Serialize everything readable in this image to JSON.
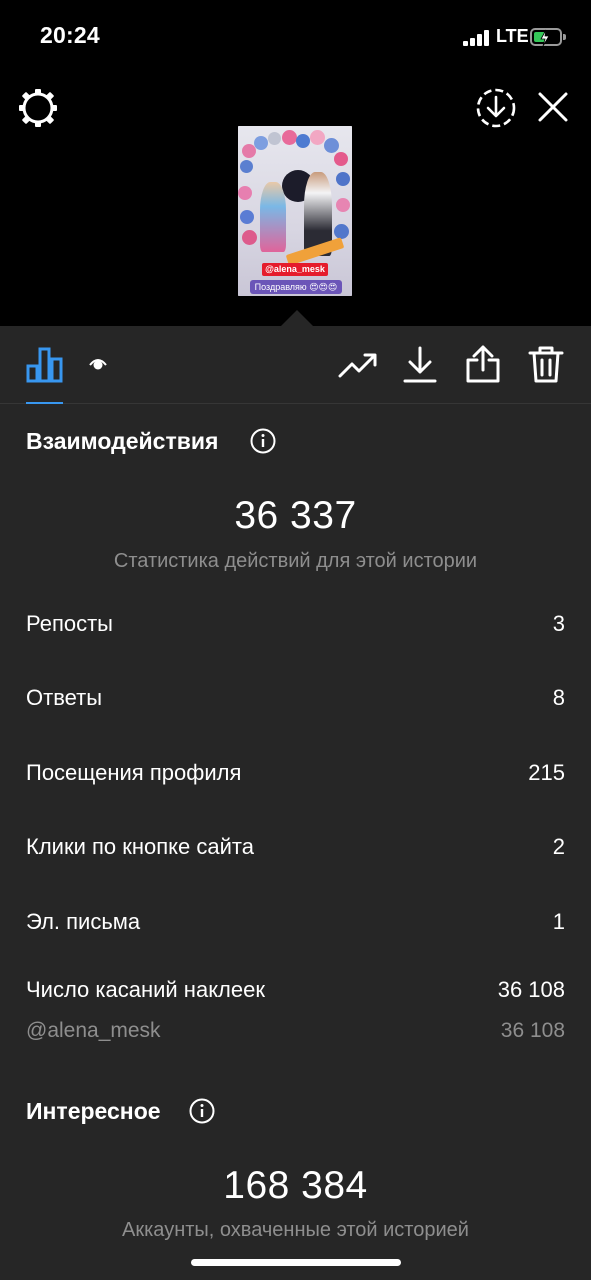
{
  "status_bar": {
    "time": "20:24",
    "network": "LTE"
  },
  "story": {
    "sticker_tag": "@alena_mesk",
    "caption": "Поздравляю 😍😍😍"
  },
  "toolbar": {
    "tabs": [
      "insights-icon",
      "eye-icon"
    ],
    "actions": [
      "trend-icon",
      "download-icon",
      "share-icon",
      "trash-icon"
    ]
  },
  "interactions": {
    "title": "Взаимодействия",
    "total": "36 337",
    "subtitle": "Статистика действий для этой истории",
    "rows": [
      {
        "label": "Репосты",
        "value": "3"
      },
      {
        "label": "Ответы",
        "value": "8"
      },
      {
        "label": "Посещения профиля",
        "value": "215"
      },
      {
        "label": "Клики по кнопке сайта",
        "value": "2"
      },
      {
        "label": "Эл. письма",
        "value": "1"
      },
      {
        "label": "Число касаний наклеек",
        "value": "36 108"
      }
    ],
    "sub_row": {
      "label": "@alena_mesk",
      "value": "36 108"
    }
  },
  "discovery": {
    "title": "Интересное",
    "total": "168 384",
    "subtitle": "Аккаунты, охваченные этой историей"
  },
  "colors": {
    "accent": "#3897f0",
    "panel": "#262626",
    "muted": "#8e8e8e"
  }
}
